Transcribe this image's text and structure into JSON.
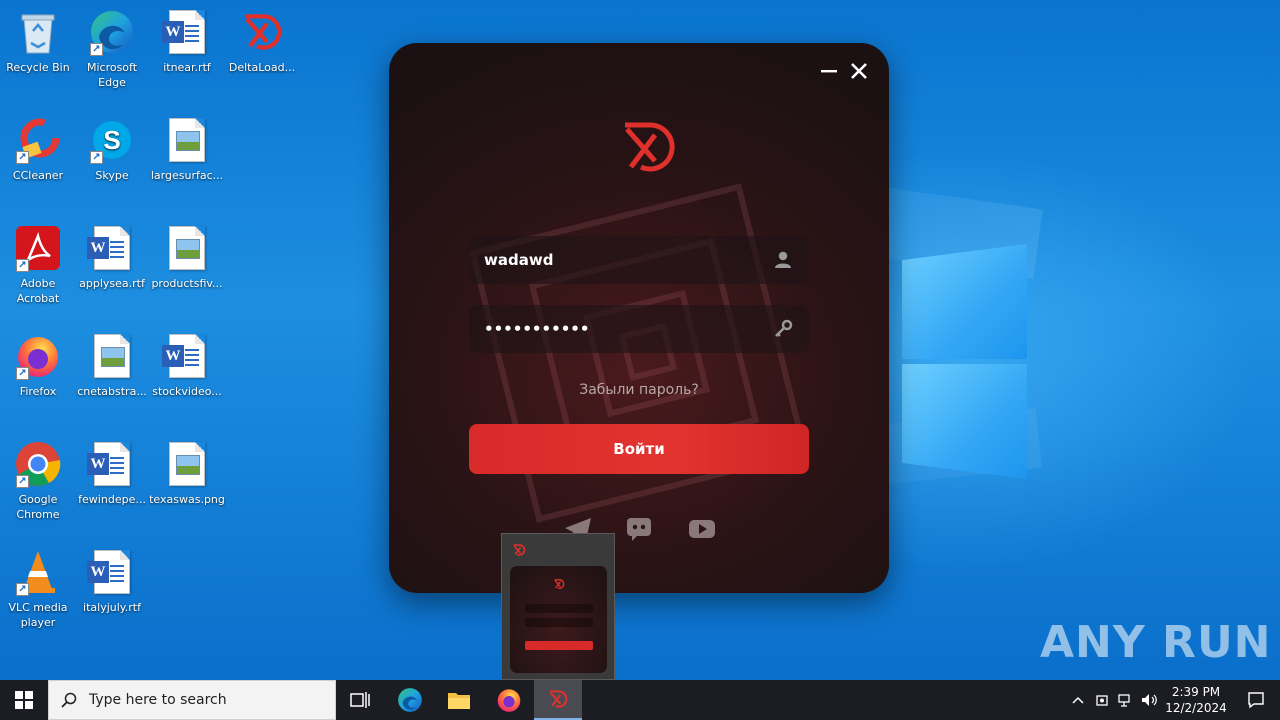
{
  "desktop": {
    "icons": [
      {
        "label": "Recycle Bin"
      },
      {
        "label": "Microsoft Edge"
      },
      {
        "label": "itnear.rtf"
      },
      {
        "label": "DeltaLoad..."
      },
      {
        "label": "CCleaner"
      },
      {
        "label": "Skype"
      },
      {
        "label": "largesurfac..."
      },
      {
        "label": "Adobe Acrobat"
      },
      {
        "label": "applysea.rtf"
      },
      {
        "label": "productsfiv..."
      },
      {
        "label": "Firefox"
      },
      {
        "label": "cnetabstra..."
      },
      {
        "label": "stockvideo..."
      },
      {
        "label": "Google Chrome"
      },
      {
        "label": "fewindepe..."
      },
      {
        "label": "texaswas.png"
      },
      {
        "label": "VLC media player"
      },
      {
        "label": "italyjuly.rtf"
      }
    ]
  },
  "app": {
    "username_value": "wadawd",
    "password_value": "•••••••••••",
    "forgot_label": "Забыли пароль?",
    "login_label": "Войти",
    "minimize_glyph": "—",
    "close_glyph": "✕",
    "accent_color": "#e0302c"
  },
  "watermark": {
    "text": "ANY RUN"
  },
  "taskbar": {
    "search_placeholder": "Type here to search",
    "time": "2:39 PM",
    "date": "12/2/2024"
  }
}
